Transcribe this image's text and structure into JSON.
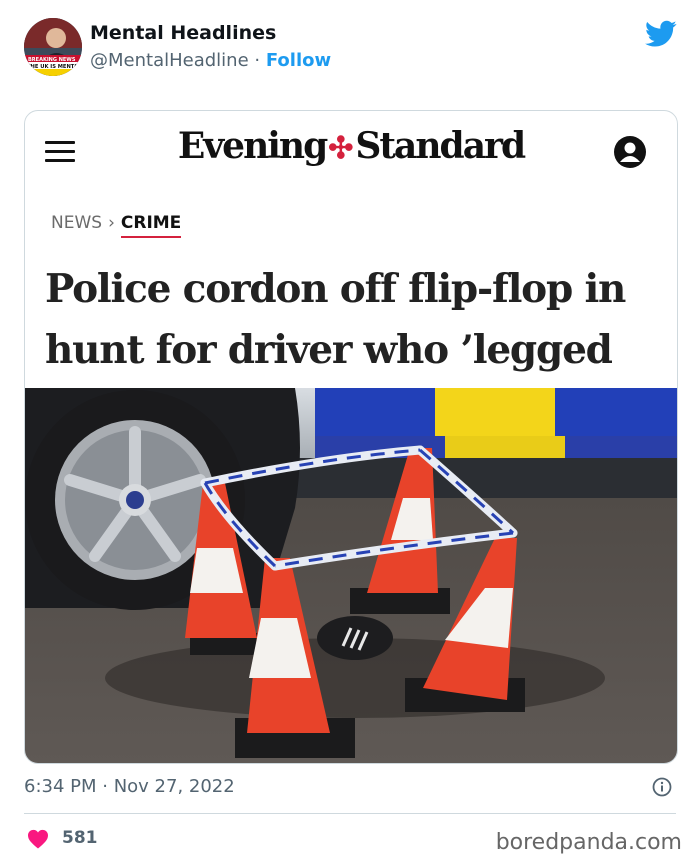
{
  "author": {
    "name": "Mental Headlines",
    "handle": "@MentalHeadline",
    "separator": "·",
    "follow_label": "Follow",
    "avatar_banner_text": "THE UK IS MENTAL",
    "avatar_tag_text": "BREAKING NEWS"
  },
  "card": {
    "masthead_left": "Evening",
    "masthead_right": "Standard",
    "breadcrumb_news": "NEWS",
    "breadcrumb_separator": "›",
    "breadcrumb_crime": "CRIME",
    "headline": "Police cordon off flip-flop in hunt for driver who ’legged it’",
    "photo_icon": "police-cordon-photo"
  },
  "tweet": {
    "timestamp": "6:34 PM · Nov 27, 2022",
    "likes": "581"
  },
  "watermark": "boredpanda.com",
  "colors": {
    "twitter_blue": "#1d9bf0",
    "heart_red": "#f91880",
    "brand_red": "#d4213d"
  }
}
